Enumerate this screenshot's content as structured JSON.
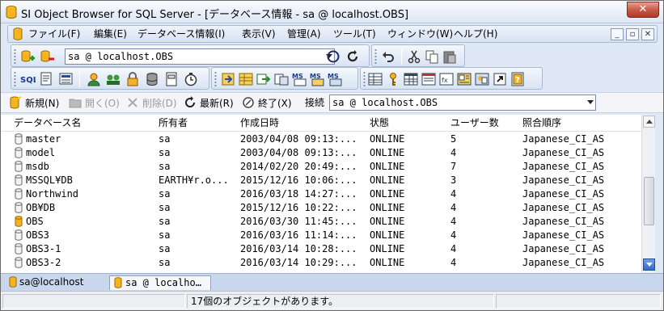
{
  "window": {
    "title": "SI Object Browser for SQL Server - [データベース情報 - sa @ localhost.OBS]",
    "close_label": "✕"
  },
  "menu": [
    {
      "label": "ファイル(F)"
    },
    {
      "label": "編集(E)"
    },
    {
      "label": "データベース情報(I)"
    },
    {
      "label": "表示(V)"
    },
    {
      "label": "管理(A)"
    },
    {
      "label": "ツール(T)"
    },
    {
      "label": "ウィンドウ(W)"
    },
    {
      "label": "ヘルプ(H)"
    }
  ],
  "mdi_controls": [
    "_",
    "▫",
    "✕"
  ],
  "toolbar": {
    "connection_value": "sa @ localhost.OBS"
  },
  "actions": {
    "new_label": "新規(N)",
    "open_label": "開く(O)",
    "delete_label": "削除(D)",
    "refresh_label": "最新(R)",
    "exit_label": "終了(X)",
    "connection_label": "接続",
    "connection_value": "sa @ localhost.OBS"
  },
  "table": {
    "columns": [
      "データベース名",
      "所有者",
      "作成日時",
      "状態",
      "ユーザー数",
      "照合順序"
    ],
    "rows": [
      {
        "name": "master",
        "owner": "sa",
        "created": "2003/04/08 09:13:...",
        "state": "ONLINE",
        "users": "5",
        "collation": "Japanese_CI_AS",
        "selected": false
      },
      {
        "name": "model",
        "owner": "sa",
        "created": "2003/04/08 09:13:...",
        "state": "ONLINE",
        "users": "4",
        "collation": "Japanese_CI_AS",
        "selected": false
      },
      {
        "name": "msdb",
        "owner": "sa",
        "created": "2014/02/20 20:49:...",
        "state": "ONLINE",
        "users": "7",
        "collation": "Japanese_CI_AS",
        "selected": false
      },
      {
        "name": "MSSQL¥DB",
        "owner": "EARTH¥r.o...",
        "created": "2015/12/16 10:06:...",
        "state": "ONLINE",
        "users": "3",
        "collation": "Japanese_CI_AS",
        "selected": false
      },
      {
        "name": "Northwind",
        "owner": "sa",
        "created": "2016/03/18 14:27:...",
        "state": "ONLINE",
        "users": "4",
        "collation": "Japanese_CI_AS",
        "selected": false
      },
      {
        "name": "OB¥DB",
        "owner": "sa",
        "created": "2015/12/16 10:22:...",
        "state": "ONLINE",
        "users": "4",
        "collation": "Japanese_CI_AS",
        "selected": false
      },
      {
        "name": "OBS",
        "owner": "sa",
        "created": "2016/03/30 11:45:...",
        "state": "ONLINE",
        "users": "4",
        "collation": "Japanese_CI_AS",
        "selected": true
      },
      {
        "name": "OBS3",
        "owner": "sa",
        "created": "2016/03/16 11:14:...",
        "state": "ONLINE",
        "users": "4",
        "collation": "Japanese_CI_AS",
        "selected": false
      },
      {
        "name": "OBS3-1",
        "owner": "sa",
        "created": "2016/03/14 10:28:...",
        "state": "ONLINE",
        "users": "4",
        "collation": "Japanese_CI_AS",
        "selected": false
      },
      {
        "name": "OBS3-2",
        "owner": "sa",
        "created": "2016/03/14 10:29:...",
        "state": "ONLINE",
        "users": "4",
        "collation": "Japanese_CI_AS",
        "selected": false
      }
    ]
  },
  "tabs": [
    {
      "label": "sa@localhost",
      "active": false
    },
    {
      "label": "sa @ localho…",
      "active": true
    }
  ],
  "status": {
    "message": "17個のオブジェクトがあります。"
  },
  "colors": {
    "db_icon_normal": "#f4f4f4",
    "db_icon_selected": "#f5b41f",
    "accent": "#2f5ea8"
  }
}
